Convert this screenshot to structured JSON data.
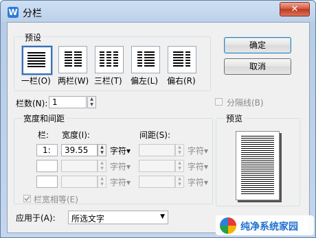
{
  "window": {
    "title": "分栏",
    "app_icon": "W",
    "close_icon": "✕"
  },
  "presets": {
    "label": "预设",
    "items": [
      {
        "label": "一栏(O)",
        "selected": true
      },
      {
        "label": "两栏(W)"
      },
      {
        "label": "三栏(T)"
      },
      {
        "label": "偏左(L)"
      },
      {
        "label": "偏右(R)"
      }
    ]
  },
  "buttons": {
    "ok": "确定",
    "cancel": "取消"
  },
  "columns": {
    "label": "栏数(N):",
    "value": "1"
  },
  "separator": {
    "label": "分隔线(B)",
    "checked": false
  },
  "width_spacing": {
    "label": "宽度和间距",
    "col_header": "栏:",
    "width_header": "宽度(I):",
    "spacing_header": "间距(S):",
    "rows": [
      {
        "col": "1:",
        "width": "39.55",
        "unit": "字符▾",
        "spacing": "",
        "spacing_unit": "字符▾"
      },
      {
        "col": "",
        "width": "",
        "unit": "字符▾",
        "spacing": "",
        "spacing_unit": "字符▾"
      },
      {
        "col": "",
        "width": "",
        "unit": "字符▾",
        "spacing": "",
        "spacing_unit": "字符▾"
      }
    ]
  },
  "equal_width": {
    "label": "栏宽相等(E)",
    "checked": true
  },
  "preview": {
    "label": "预览"
  },
  "apply_to": {
    "label": "应用于(A):",
    "value": "所选文字"
  },
  "watermark": {
    "text": "纯净系统家园"
  }
}
